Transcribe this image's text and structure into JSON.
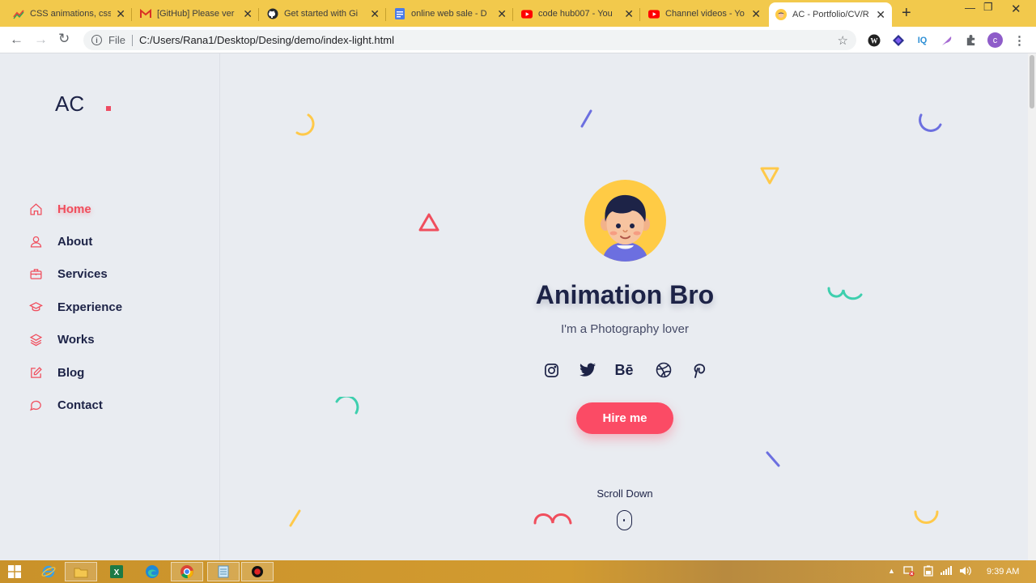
{
  "browser": {
    "tabs": [
      {
        "title": "CSS animations, css",
        "icon": "chart-favicon"
      },
      {
        "title": "[GitHub] Please ver",
        "icon": "gmail-favicon"
      },
      {
        "title": "Get started with Gi",
        "icon": "github-favicon"
      },
      {
        "title": "online web sale - D",
        "icon": "docs-favicon"
      },
      {
        "title": "code hub007 - You",
        "icon": "youtube-favicon"
      },
      {
        "title": "Channel videos - Yo",
        "icon": "youtube-favicon"
      },
      {
        "title": "AC - Portfolio/CV/R",
        "icon": "avatar-favicon",
        "active": true
      }
    ],
    "new_tab": "+",
    "address_prefix": "File",
    "url": "C:/Users/Rana1/Desktop/Desing/demo/index-light.html",
    "profile_initial": "c",
    "extension_label": "IQ"
  },
  "site": {
    "logo": "AC",
    "nav": [
      {
        "label": "Home",
        "icon": "home-icon",
        "active": true
      },
      {
        "label": "About",
        "icon": "user-icon"
      },
      {
        "label": "Services",
        "icon": "briefcase-icon"
      },
      {
        "label": "Experience",
        "icon": "graduation-cap-icon"
      },
      {
        "label": "Works",
        "icon": "layers-icon"
      },
      {
        "label": "Blog",
        "icon": "edit-icon"
      },
      {
        "label": "Contact",
        "icon": "chat-icon"
      }
    ],
    "hero": {
      "name": "Animation Bro",
      "tagline": "I'm a Photography lover",
      "socials": [
        "instagram-icon",
        "twitter-icon",
        "behance-icon",
        "dribbble-icon",
        "pinterest-icon"
      ],
      "behance_text": "Bē",
      "cta": "Hire me",
      "scroll_label": "Scroll Down"
    },
    "colors": {
      "accent": "#fb4b65",
      "text": "#1d2347",
      "background": "#e9ecf1",
      "deco_yellow": "#ffc94a",
      "deco_blue": "#6c6fe0",
      "deco_teal": "#3ecfae",
      "deco_red": "#f04e5d"
    }
  },
  "taskbar": {
    "clock": "9:39 AM"
  }
}
